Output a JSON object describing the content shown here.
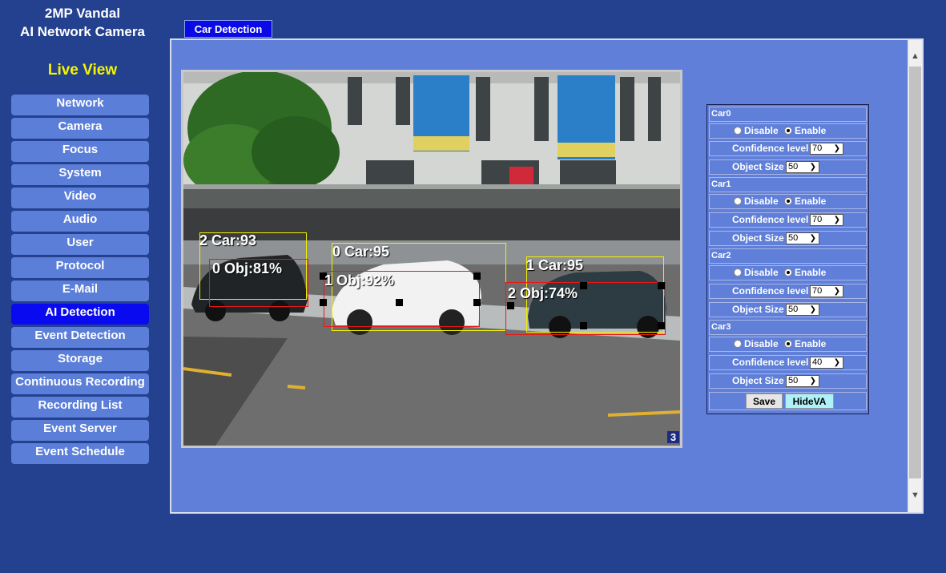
{
  "brand": {
    "line1": "2MP Vandal",
    "line2": "AI Network Camera"
  },
  "live_view": "Live View",
  "menu": [
    "Network",
    "Camera",
    "Focus",
    "System",
    "Video",
    "Audio",
    "User",
    "Protocol",
    "E-Mail",
    "AI Detection",
    "Event Detection",
    "Storage",
    "Continuous Recording",
    "Recording List",
    "Event Server",
    "Event Schedule"
  ],
  "active_menu": "AI Detection",
  "tab": "Car Detection",
  "video": {
    "car_labels": [
      "2 Car:93",
      "0 Car:95",
      "1 Car:95"
    ],
    "obj_labels": [
      "0 Obj:81%",
      "1 Obj:92%",
      "2 Obj:74%"
    ],
    "channel": "3"
  },
  "settings": {
    "cars": [
      {
        "name": "Car0",
        "disable": "Disable",
        "enable": "Enable",
        "conf_label": "Confidence level",
        "conf": "70",
        "size_label": "Object Size",
        "size": "50"
      },
      {
        "name": "Car1",
        "disable": "Disable",
        "enable": "Enable",
        "conf_label": "Confidence level",
        "conf": "70",
        "size_label": "Object Size",
        "size": "50"
      },
      {
        "name": "Car2",
        "disable": "Disable",
        "enable": "Enable",
        "conf_label": "Confidence level",
        "conf": "70",
        "size_label": "Object Size",
        "size": "50"
      },
      {
        "name": "Car3",
        "disable": "Disable",
        "enable": "Enable",
        "conf_label": "Confidence level",
        "conf": "40",
        "size_label": "Object Size",
        "size": "50"
      }
    ],
    "save": "Save",
    "hideva": "HideVA"
  },
  "colors": {
    "background": "#24418f",
    "panel": "#5f7fd9",
    "menu_item": "#5b7ed9",
    "menu_active": "#0a0af0",
    "live_view": "#f5f500"
  }
}
